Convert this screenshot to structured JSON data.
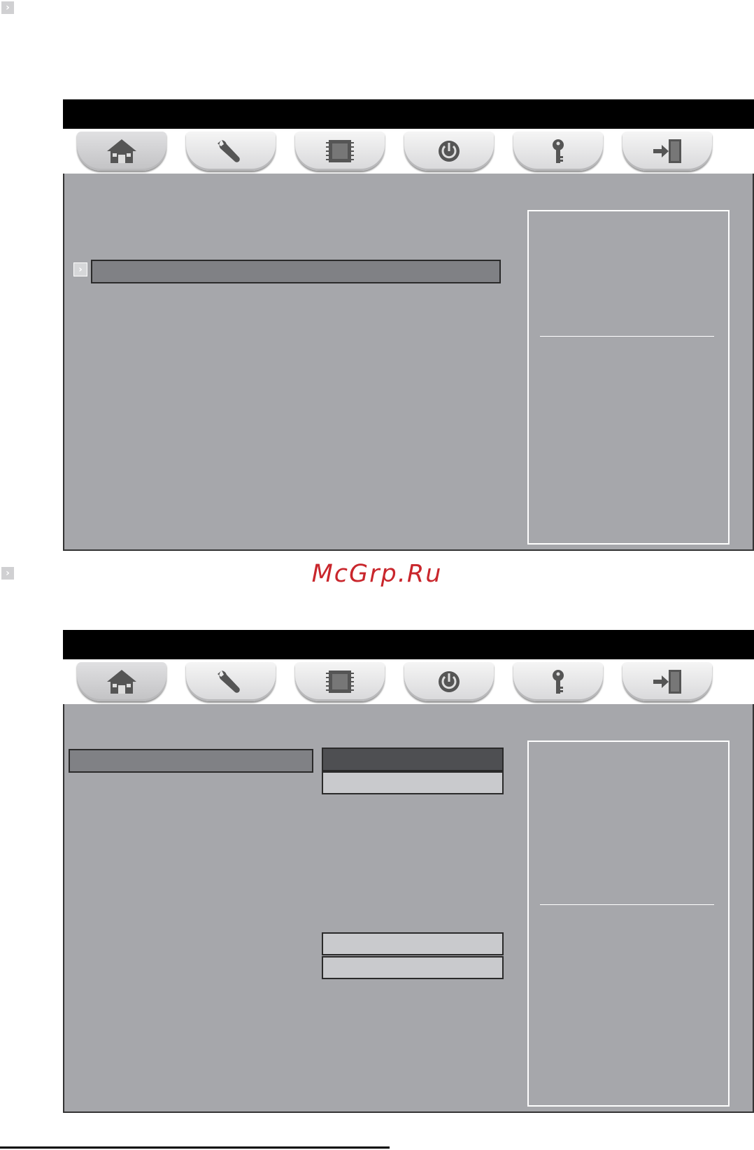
{
  "watermark": "McGrp.Ru",
  "bullet_glyph": "›",
  "colors": {
    "title_bar": "#000000",
    "screen_bg": "#a6a7ab",
    "selected_row": "#808185",
    "dark_row": "#4e4f52",
    "light_row": "#c9cacd",
    "watermark": "#c9262c"
  },
  "tabs": [
    {
      "icon": "home-icon",
      "active": true
    },
    {
      "icon": "wrench-icon",
      "active": false
    },
    {
      "icon": "chip-icon",
      "active": false
    },
    {
      "icon": "power-icon",
      "active": false
    },
    {
      "icon": "key-icon",
      "active": false
    },
    {
      "icon": "exit-door-icon",
      "active": false
    }
  ]
}
